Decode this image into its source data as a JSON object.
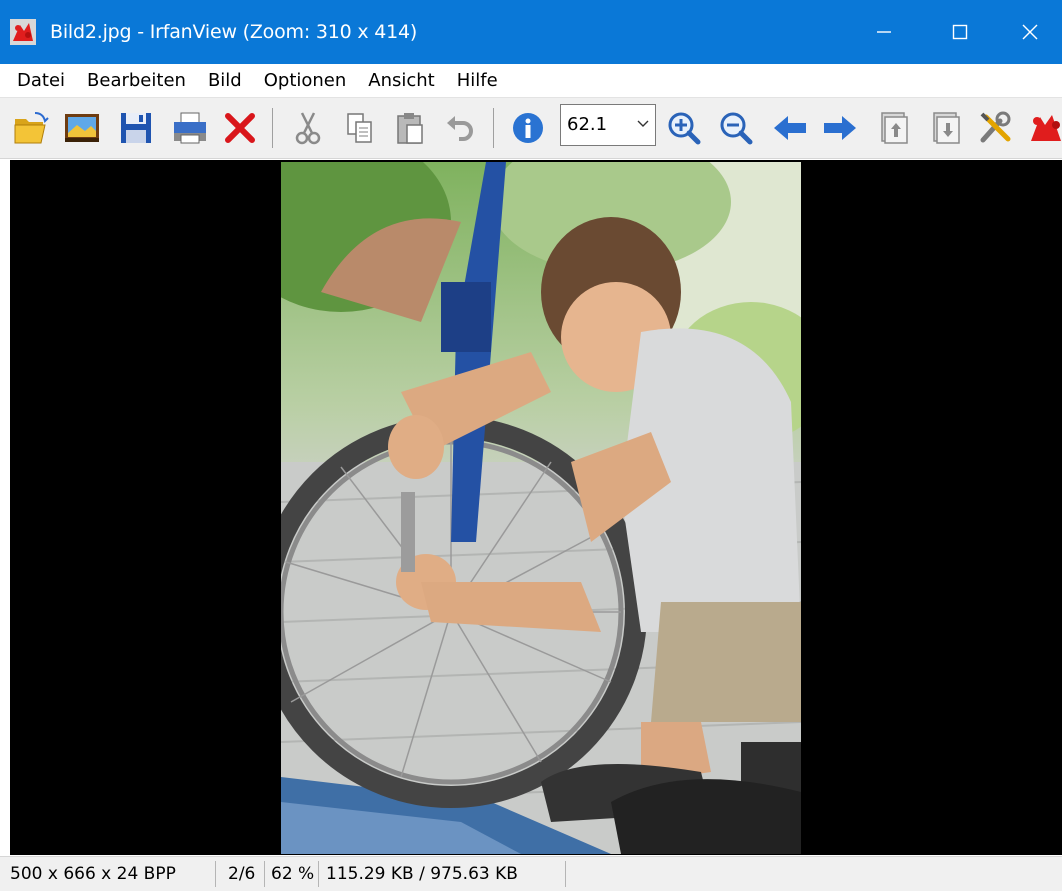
{
  "window": {
    "title": "Bild2.jpg - IrfanView (Zoom: 310 x 414)",
    "accent_color": "#0a78d7",
    "controls": {
      "minimize_icon": "minimize-icon",
      "maximize_icon": "maximize-icon",
      "close_icon": "close-icon"
    }
  },
  "menu": {
    "items": [
      {
        "label": "Datei"
      },
      {
        "label": "Bearbeiten"
      },
      {
        "label": "Bild"
      },
      {
        "label": "Optionen"
      },
      {
        "label": "Ansicht"
      },
      {
        "label": "Hilfe"
      }
    ]
  },
  "toolbar": {
    "buttons": [
      {
        "icon": "open-folder-icon"
      },
      {
        "icon": "slideshow-icon"
      },
      {
        "icon": "save-icon"
      },
      {
        "icon": "print-icon"
      },
      {
        "icon": "delete-icon"
      },
      {
        "icon": "cut-icon"
      },
      {
        "icon": "copy-icon"
      },
      {
        "icon": "paste-icon"
      },
      {
        "icon": "undo-icon"
      },
      {
        "icon": "info-icon"
      },
      {
        "icon": "zoom-in-icon"
      },
      {
        "icon": "zoom-out-icon"
      },
      {
        "icon": "previous-arrow-icon"
      },
      {
        "icon": "next-arrow-icon"
      },
      {
        "icon": "first-file-icon"
      },
      {
        "icon": "last-file-icon"
      },
      {
        "icon": "tools-icon"
      },
      {
        "icon": "irfanview-icon"
      }
    ],
    "zoom": {
      "value": "62.1"
    }
  },
  "viewport": {
    "background": "#000000",
    "image_description_icon": "photo-boy-repairing-bicycle"
  },
  "status": {
    "dimensions": "500 x 666 x 24 BPP",
    "index": "2/6",
    "zoom_percent": "62 %",
    "file_size": "115.29 KB / 975.63 KB"
  }
}
